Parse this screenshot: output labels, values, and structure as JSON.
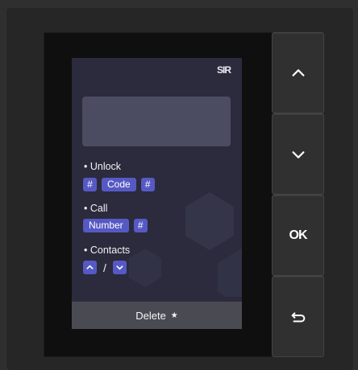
{
  "screen": {
    "status_icon_text": "SIR",
    "sections": {
      "unlock": {
        "label": "• Unlock",
        "chips": [
          "#",
          "Code",
          "#"
        ]
      },
      "call": {
        "label": "• Call",
        "chips": [
          "Number",
          "#"
        ]
      },
      "contacts": {
        "label": "• Contacts",
        "separator": "/"
      }
    },
    "footer": {
      "label": "Delete",
      "star": "★"
    }
  },
  "hardware_buttons": {
    "up_icon": "chevron-up-icon",
    "down_icon": "chevron-down-icon",
    "ok_label": "OK",
    "back_icon": "return-arrow-icon"
  },
  "colors": {
    "screen_bg": "#2b2b3d",
    "chip_bg": "#5659c4",
    "input_box_bg": "#4b4b61",
    "footer_bg": "#4a4a52",
    "device_bg": "#262627"
  }
}
